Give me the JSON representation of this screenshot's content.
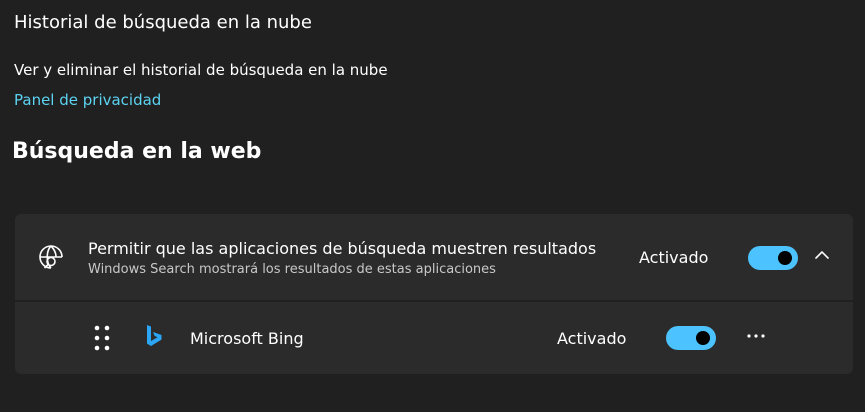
{
  "cloud_history": {
    "title": "Historial de búsqueda en la nube",
    "description": "Ver y eliminar el historial de búsqueda en la nube",
    "privacy_link": "Panel de privacidad"
  },
  "web_search": {
    "section_title": "Búsqueda en la web",
    "setting": {
      "icon": "globe-search-icon",
      "title": "Permitir que las aplicaciones de búsqueda muestren resultados",
      "subtitle": "Windows Search mostrará los resultados de estas aplicaciones",
      "status": "Activado",
      "enabled": true,
      "expanded": true
    },
    "apps": [
      {
        "name": "Microsoft Bing",
        "icon": "bing-icon",
        "status": "Activado",
        "enabled": true
      }
    ]
  },
  "colors": {
    "background": "#202020",
    "card": "#2b2b2b",
    "accent": "#4cc2ff",
    "link": "#5cd3f2"
  }
}
